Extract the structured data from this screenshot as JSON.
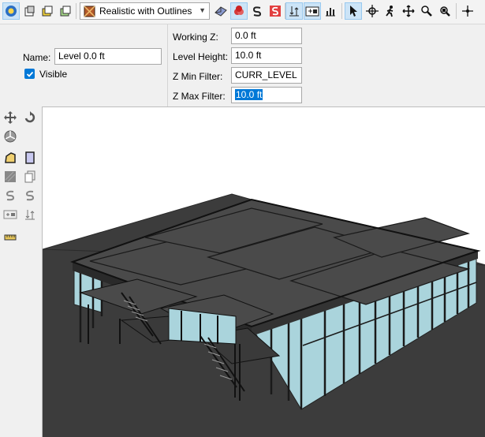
{
  "toolbar": {
    "view_mode_label": "Realistic with Outlines",
    "buttons": [
      {
        "icon": "select-view-icon",
        "active": true
      },
      {
        "icon": "box-view-1-icon"
      },
      {
        "icon": "box-view-2-icon"
      },
      {
        "icon": "box-view-3-icon"
      },
      {
        "icon": "section-box-icon"
      },
      {
        "icon": "clash-icon"
      },
      {
        "icon": "snap-s-icon"
      },
      {
        "icon": "snap-s-red-icon"
      },
      {
        "icon": "level-icon",
        "active": true
      },
      {
        "icon": "level-plus-icon",
        "active": true
      },
      {
        "icon": "chart-icon"
      },
      {
        "icon": "pointer-icon",
        "active": true
      },
      {
        "icon": "orbit-icon"
      },
      {
        "icon": "walk-icon"
      },
      {
        "icon": "pan-icon"
      },
      {
        "icon": "zoom-icon"
      },
      {
        "icon": "zoom-extents-icon"
      },
      {
        "icon": "crosshair-icon"
      }
    ]
  },
  "level": {
    "name_label": "Name:",
    "name_value": "Level 0.0 ft",
    "visible_label": "Visible",
    "visible_checked": true,
    "working_z_label": "Working Z:",
    "working_z_value": "0.0 ft",
    "level_height_label": "Level Height:",
    "level_height_value": "10.0 ft",
    "z_min_label": "Z Min Filter:",
    "z_min_value": "CURR_LEVEL",
    "z_max_label": "Z Max Filter:",
    "z_max_value": "10.0 ft"
  },
  "sidebar": {
    "tools": [
      "move-icon",
      "rotate-icon",
      "pie-icon",
      "polygon-icon",
      "rect-icon",
      "fill-icon",
      "copy-icon",
      "snap-icon",
      "snap-alt-icon",
      "level-tag-icon",
      "level-height-icon",
      "ruler-icon"
    ]
  },
  "colors": {
    "accent": "#0078d7",
    "ground": "#3c3c3c",
    "roof": "#4a4a4a",
    "glass": "#a9d4dc"
  }
}
